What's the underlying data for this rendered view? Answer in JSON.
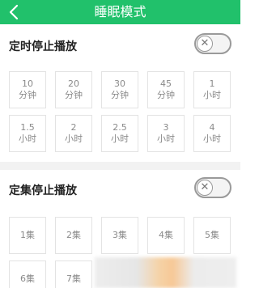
{
  "header": {
    "title": "睡眠模式",
    "back_icon": "chevron-left-icon"
  },
  "timer_section": {
    "title": "定时停止播放",
    "toggle_state": "off",
    "options": [
      {
        "value": "10",
        "unit": "分钟"
      },
      {
        "value": "20",
        "unit": "分钟"
      },
      {
        "value": "30",
        "unit": "分钟"
      },
      {
        "value": "45",
        "unit": "分钟"
      },
      {
        "value": "1",
        "unit": "小时"
      },
      {
        "value": "1.5",
        "unit": "小时"
      },
      {
        "value": "2",
        "unit": "小时"
      },
      {
        "value": "2.5",
        "unit": "小时"
      },
      {
        "value": "3",
        "unit": "小时"
      },
      {
        "value": "4",
        "unit": "小时"
      }
    ]
  },
  "episode_section": {
    "title": "定集停止播放",
    "toggle_state": "off",
    "options": [
      "1集",
      "2集",
      "3集",
      "4集",
      "5集",
      "6集",
      "7集"
    ]
  },
  "colors": {
    "accent": "#21c16b",
    "background_gap": "#f2f2f2"
  }
}
